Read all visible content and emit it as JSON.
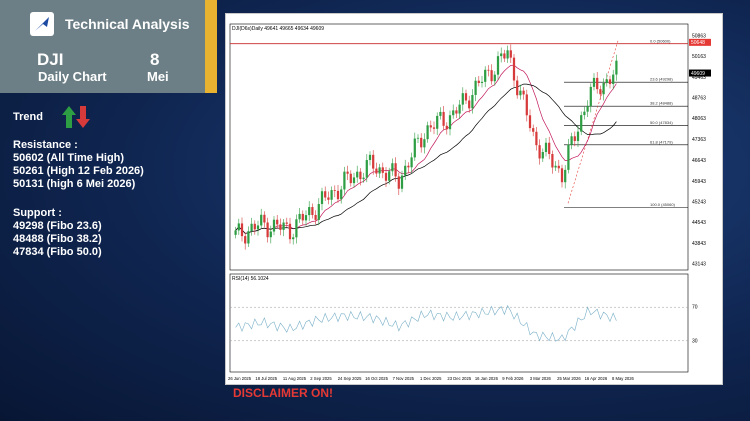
{
  "header": {
    "brand": "Technical Analysis",
    "ticker": "DJI",
    "subtitle": "Daily Chart",
    "day": "8",
    "month": "Mei"
  },
  "trend": {
    "label": "Trend",
    "up_color": "#2e9e44",
    "down_color": "#d63a3a"
  },
  "resistance": {
    "title": "Resistance :",
    "items": [
      "50602 (All Time High)",
      "50261 (High 12 Feb 2026)",
      "50131 (high 6 Mei 2026)"
    ]
  },
  "support": {
    "title": "Support :",
    "items": [
      "49298 (Fibo 23.6)",
      "48488 (Fibo 38.2)",
      "47834 (Fibo 50.0)"
    ]
  },
  "chart": {
    "header_text": "DJI(D6s)Daily  49641 49665 49634 49609",
    "price_ticks": [
      "50863",
      "50163",
      "49463",
      "48763",
      "48063",
      "47363",
      "46643",
      "45943",
      "45243",
      "44543",
      "43843",
      "43143"
    ],
    "current_price": "49609",
    "resistance_tag": "50648",
    "fib_levels": [
      {
        "label": "0.0 (50600)"
      },
      {
        "label": "23.6 (49298)"
      },
      {
        "label": "38.2 (48488)"
      },
      {
        "label": "50.0 (47834)"
      },
      {
        "label": "61.8 (47179)"
      },
      {
        "label": "100.0 (45060)"
      }
    ],
    "rsi_label": "RSI(14) 56.1024",
    "rsi_ticks": [
      "70",
      "30"
    ],
    "x_labels": [
      "26 Jun 2025",
      "18 Jul 2025",
      "11 Aug 2025",
      "2 Sep 2025",
      "24 Sep 2025",
      "16 Oct 2025",
      "7 Nov 2025",
      "1 Dec 2025",
      "23 Dec 2025",
      "16 Jan 2026",
      "9 Feb 2026",
      "3 Mar 2026",
      "25 Mar 2026",
      "16 Apr 2026",
      "8 May 2026"
    ]
  },
  "chart_data": {
    "type": "line",
    "title": "DJI(D6s)Daily",
    "x": [
      "26 Jun 2025",
      "18 Jul 2025",
      "11 Aug 2025",
      "2 Sep 2025",
      "24 Sep 2025",
      "16 Oct 2025",
      "7 Nov 2025",
      "1 Dec 2025",
      "23 Dec 2025",
      "16 Jan 2026",
      "9 Feb 2026",
      "3 Mar 2026",
      "25 Mar 2026",
      "16 Apr 2026",
      "8 May 2026"
    ],
    "series": [
      {
        "name": "",
        "values": [
          44100,
          44500,
          44300,
          45100,
          45900,
          46500,
          46000,
          47700,
          48200,
          49300,
          50300,
          47300,
          46200,
          48900,
          49609
        ]
      }
    ],
    "rsi": [
      46,
      52,
      44,
      55,
      60,
      58,
      47,
      62,
      58,
      63,
      68,
      37,
      32,
      66,
      56
    ],
    "ylim": [
      43143,
      50863
    ],
    "rsi_ylim": [
      0,
      100
    ]
  },
  "disclaimer": "DISCLAIMER ON!"
}
